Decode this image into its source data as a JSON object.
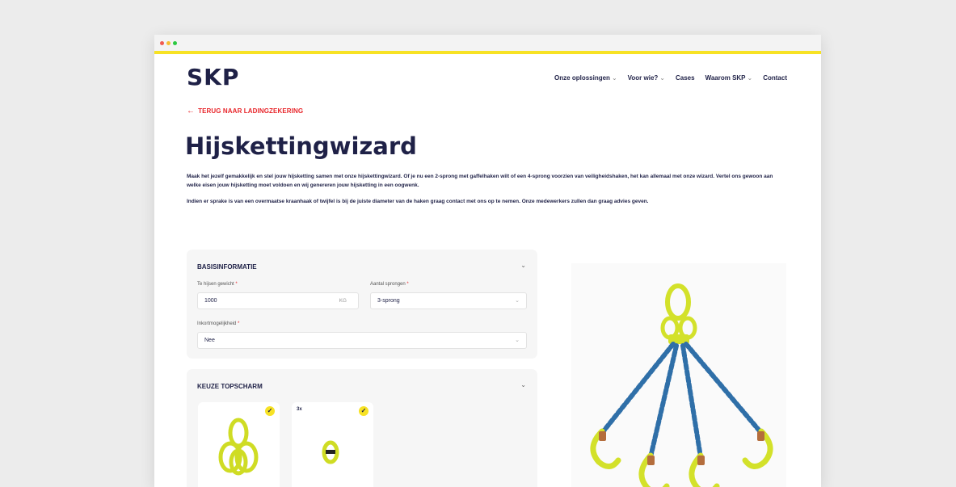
{
  "header": {
    "logo": "SKP",
    "nav": [
      {
        "label": "Onze oplossingen",
        "has_dropdown": true
      },
      {
        "label": "Voor wie?",
        "has_dropdown": true
      },
      {
        "label": "Cases",
        "has_dropdown": false
      },
      {
        "label": "Waarom SKP",
        "has_dropdown": true
      },
      {
        "label": "Contact",
        "has_dropdown": false
      }
    ]
  },
  "back_link": "TERUG NAAR LADINGZEKERING",
  "page_title": "Hijskettingwizard",
  "intro": [
    "Maak het jezelf gemakkelijk en stel jouw hijsketting samen met onze hijskettingwizard. Of je nu een 2-sprong met gaffelhaken wilt of een 4-sprong voorzien van veiligheidshaken, het kan allemaal met onze wizard. Vertel ons gewoon aan welke eisen jouw hijsketting moet voldoen en wij genereren jouw hijsketting in een oogwenk.",
    "Indien er sprake is van een overmaatse kraanhaak of twijfel is bij de juiste diameter van de haken graag contact met ons op te nemen. Onze medewerkers zullen dan graag advies geven."
  ],
  "basis": {
    "title": "BASISINFORMATIE",
    "weight": {
      "label": "Te hijsen gewicht",
      "value": "1000",
      "unit": "KG"
    },
    "legs": {
      "label": "Aantal sprongen",
      "value": "3-sprong"
    },
    "shorten": {
      "label": "Inkortmogelijkheid",
      "value": "Nee"
    }
  },
  "topscharm": {
    "title": "KEUZE TOPSCHARM",
    "options": [
      {
        "qty": "",
        "selected": true,
        "icon": "master-link-assembly-icon"
      },
      {
        "qty": "3x",
        "selected": true,
        "icon": "coupling-link-icon"
      }
    ]
  },
  "colors": {
    "accent_yellow": "#f7e224",
    "brand_navy": "#1f2147",
    "alert_red": "#e8262b",
    "chain_blue": "#2f6fa8",
    "hook_green": "#d3e12a"
  }
}
